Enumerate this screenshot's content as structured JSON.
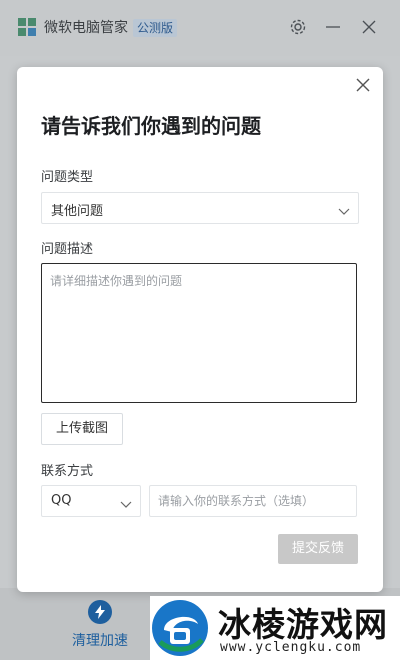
{
  "app": {
    "title": "微软电脑管家",
    "edition": "公测版",
    "brand_color": "#1e5f9e",
    "bottom_nav": {
      "boost_label": "清理加速",
      "boost_icon": "lightning-icon"
    }
  },
  "dialog": {
    "title": "请告诉我们你遇到的问题",
    "issue_type": {
      "label": "问题类型",
      "selected": "其他问题"
    },
    "description": {
      "label": "问题描述",
      "placeholder": "请详细描述你遇到的问题",
      "value": ""
    },
    "upload_label": "上传截图",
    "contact": {
      "label": "联系方式",
      "method_selected": "QQ",
      "placeholder": "请输入你的联系方式（选填）",
      "value": ""
    },
    "submit_label": "提交反馈",
    "submit_disabled_color": "#c8c8c8"
  },
  "watermark": {
    "main_text": "冰棱游戏网",
    "sub_text": "www.yclengku.com"
  }
}
